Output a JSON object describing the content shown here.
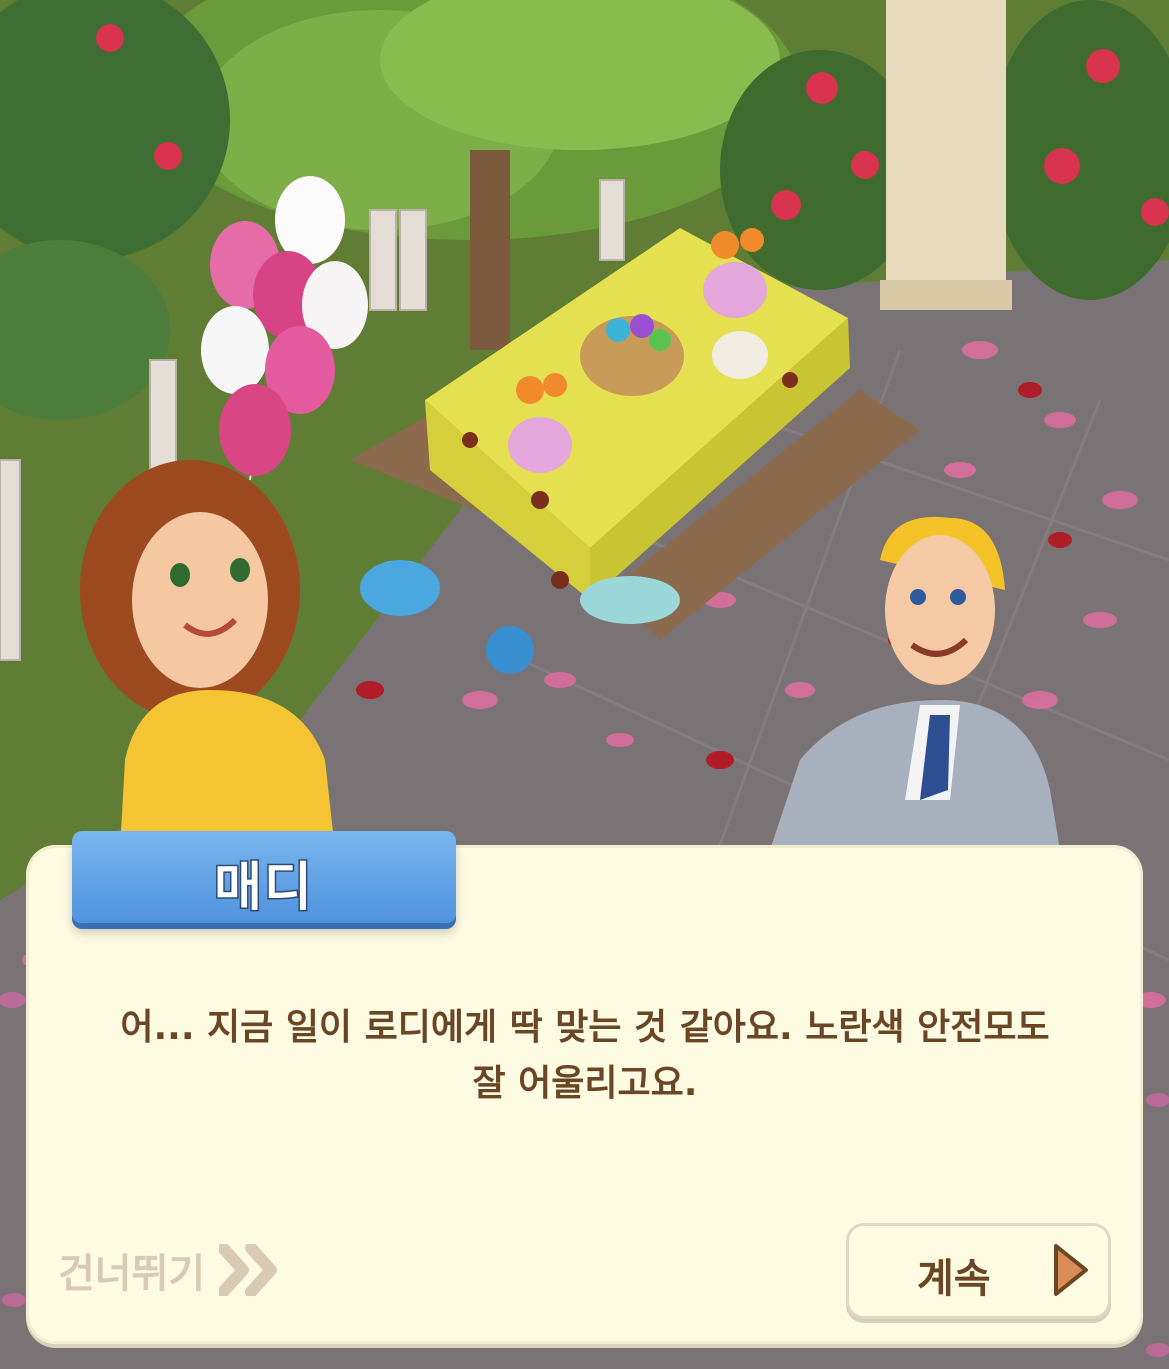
{
  "dialog": {
    "speaker_name": "매디",
    "line1": "어... 지금 일이 로디에게 딱 맞는 것 같아요. 노란색 안전모도",
    "line2": "잘 어울리고요."
  },
  "controls": {
    "skip_label": "건너뛰기",
    "continue_label": "계속"
  },
  "colors": {
    "dialog_bg": "#fefbe3",
    "name_tag": "#4f93dd",
    "text_brown": "#6b4624",
    "skip_gray": "#d8cbb2",
    "continue_arrow": "#d98c55"
  },
  "icons": {
    "skip": "double-chevron-right-icon",
    "continue": "play-triangle-icon"
  }
}
